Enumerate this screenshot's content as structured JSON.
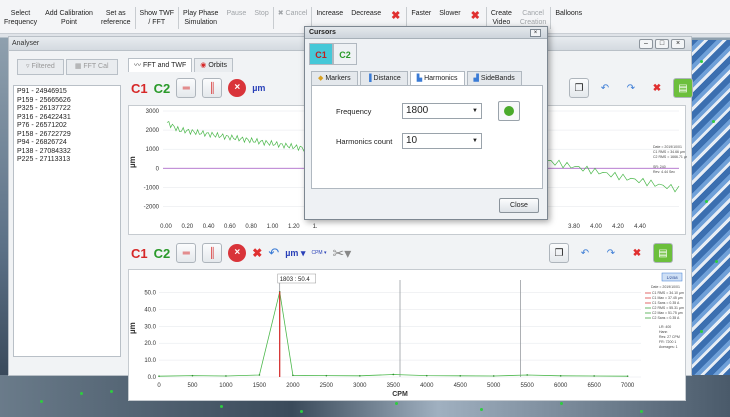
{
  "toolbar": {
    "items": [
      {
        "label": "Select\nFrequency",
        "enabled": true
      },
      {
        "label": "Add Calibration\nPoint",
        "enabled": true
      },
      {
        "label": "Set as\nreference",
        "enabled": true
      },
      {
        "label": "Show TWF\n/ FFT",
        "enabled": true
      },
      {
        "label": "Play Phase\nSimulation",
        "enabled": true
      },
      {
        "label": "Pause",
        "enabled": false
      },
      {
        "label": "Stop",
        "enabled": false
      },
      {
        "label": "Cancel",
        "enabled": false
      },
      {
        "label": "Increase",
        "enabled": true
      },
      {
        "label": "Decrease",
        "enabled": true
      },
      {
        "label": "Faster",
        "enabled": true
      },
      {
        "label": "Slower",
        "enabled": true
      },
      {
        "label": "Create\nVideo",
        "enabled": true
      },
      {
        "label": "Cancel\nCreation",
        "enabled": false
      },
      {
        "label": "Balloons",
        "enabled": true
      }
    ]
  },
  "analyser": {
    "title": "Analyser",
    "filter_tabs": [
      "Filtered",
      "FFT Cal"
    ],
    "points": [
      "P91 - 24946915",
      "P159 - 25665626",
      "P325 - 26137722",
      "P316 - 26422431",
      "P76 - 26571202",
      "P158 - 26722729",
      "P94 - 26826724",
      "P138 - 27084332",
      "P225 - 27113313"
    ],
    "tabs": [
      "FFT and TWF",
      "Orbits"
    ],
    "unit_top": "µm",
    "unit_bottom": "µm",
    "cpm_label": "CPM"
  },
  "twf_chart": {
    "type": "line",
    "y_ticks": [
      "3000",
      "2000",
      "1000",
      "0",
      "-1000",
      "-2000"
    ],
    "x_ticks_left": [
      "0.00",
      "0.20",
      "0.40",
      "0.60",
      "0.80",
      "1.00",
      "1.20",
      "1."
    ],
    "x_ticks_right": [
      "3.80",
      "4.00",
      "4.20",
      "4.40"
    ],
    "ylabel": "µm",
    "info": [
      "Date = 2019/10/01",
      "C1 RMS = 34.66 µm",
      "C2 RMS = 1666.71 µm",
      "",
      "SR: 240",
      "Rev: 4.44 Sec"
    ]
  },
  "chart_data": {
    "type": "line",
    "x": [
      0,
      500,
      1000,
      1500,
      1803,
      2000,
      2500,
      3000,
      3500,
      4000,
      4500,
      5000,
      5500,
      6000,
      6500,
      7000
    ],
    "xlabel": "CPM",
    "ylabel": "µm",
    "xlim": [
      0,
      7200
    ],
    "ylim": [
      0,
      55
    ],
    "x_ticks": [
      "0",
      "500",
      "1000",
      "1500",
      "2000",
      "2500",
      "3000",
      "3500",
      "4000",
      "4500",
      "5000",
      "5500",
      "6000",
      "6500",
      "7000"
    ],
    "y_ticks": [
      "0.0",
      "10.0",
      "20.0",
      "30.0",
      "40.0",
      "50.0"
    ],
    "cursor_label": "1803 : 50.4",
    "cursors": [
      1803,
      3600,
      5400
    ],
    "series": [
      {
        "values": [
          0.5,
          0.8,
          0.6,
          1.2,
          50.4,
          1.0,
          0.8,
          0.7,
          1.5,
          0.8,
          0.7,
          0.6,
          1.2,
          0.7,
          0.6,
          0.5
        ]
      }
    ],
    "legend": [
      "C1 RMS = 34.10 µm",
      "C1 Max = 37.45 µm",
      "C1 Sans = 0.35 A",
      "C2 RMS = 55.31 µm",
      "C2 Max = 51.75 µm",
      "C2 Sans = 0.35 A"
    ],
    "info": [
      "Date = 2019/10/01",
      "LR: 400",
      "Hann",
      "Res: 27 CPM",
      "FR: 7200 1",
      "Averages: 1"
    ],
    "badge": "1/2/58"
  },
  "cursors_dialog": {
    "title": "Cursors",
    "cursor_tabs": [
      "C1",
      "C2"
    ],
    "tabs": [
      "Markers",
      "Distance",
      "Harmonics",
      "SideBands"
    ],
    "active_tab": "Harmonics",
    "frequency_label": "Frequency",
    "frequency_value": "1800",
    "harmonics_label": "Harmonics count",
    "harmonics_value": "10",
    "close_label": "Close"
  },
  "colors": {
    "c1": "#d62828",
    "c2": "#2a9a2a",
    "accent": "#45c8d8"
  }
}
